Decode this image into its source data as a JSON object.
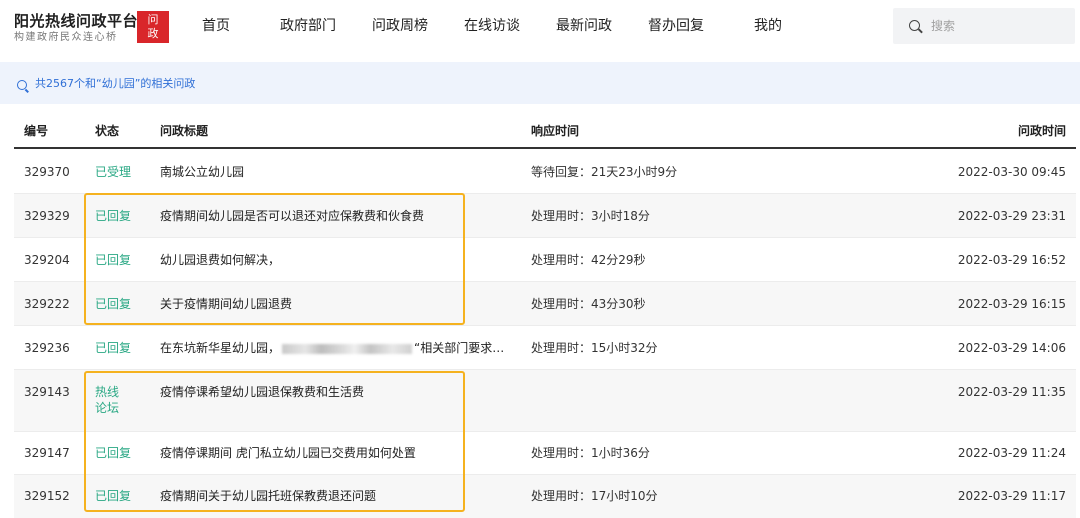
{
  "header": {
    "logo_title": "阳光热线问政平台",
    "logo_subtitle": "构建政府民众连心桥",
    "logo_badge_top": "问",
    "logo_badge_bottom": "政",
    "nav": [
      "首页",
      "政府部门",
      "问政周榜",
      "在线访谈",
      "最新问政",
      "督办回复",
      "我的"
    ],
    "search_placeholder": "搜索"
  },
  "info_bar": {
    "text": "共2567个和“幼儿园”的相关问政"
  },
  "table": {
    "headers": {
      "id": "编号",
      "status": "状态",
      "title": "问政标题",
      "response": "响应时间",
      "time": "问政时间"
    },
    "rows": [
      {
        "id": "329370",
        "status": "已受理",
        "title": "南城公立幼儿园",
        "response": "等待回复：21天23小时9分",
        "time": "2022-03-30 09:45"
      },
      {
        "id": "329329",
        "status": "已回复",
        "title": "疫情期间幼儿园是否可以退还对应保教费和伙食费",
        "response": "处理用时：3小时18分",
        "time": "2022-03-29 23:31"
      },
      {
        "id": "329204",
        "status": "已回复",
        "title": "幼儿园退费如何解决，",
        "response": "处理用时：42分29秒",
        "time": "2022-03-29 16:52"
      },
      {
        "id": "329222",
        "status": "已回复",
        "title": "关于疫情期间幼儿园退费",
        "response": "处理用时：43分30秒",
        "time": "2022-03-29 16:15"
      },
      {
        "id": "329236",
        "status": "已回复",
        "title_prefix": "在东坑新华星幼儿园，",
        "title_suffix": "“相关部门要求…",
        "response": "处理用时：15小时32分",
        "time": "2022-03-29 14:06"
      },
      {
        "id": "329143",
        "status": "热线论坛",
        "title": "疫情停课希望幼儿园退保教费和生活费",
        "response": "",
        "time": "2022-03-29 11:35"
      },
      {
        "id": "329147",
        "status": "已回复",
        "title": "疫情停课期间 虎门私立幼儿园已交费用如何处置",
        "response": "处理用时：1小时36分",
        "time": "2022-03-29 11:24"
      },
      {
        "id": "329152",
        "status": "已回复",
        "title": "疫情期间关于幼儿园托班保教费退还问题",
        "response": "处理用时：17小时10分",
        "time": "2022-03-29 11:17"
      }
    ]
  },
  "colors": {
    "status_green": "#2aa884",
    "highlight_orange": "#f5b21f",
    "info_blue": "#2f6fd6",
    "logo_red": "#d9262a"
  }
}
